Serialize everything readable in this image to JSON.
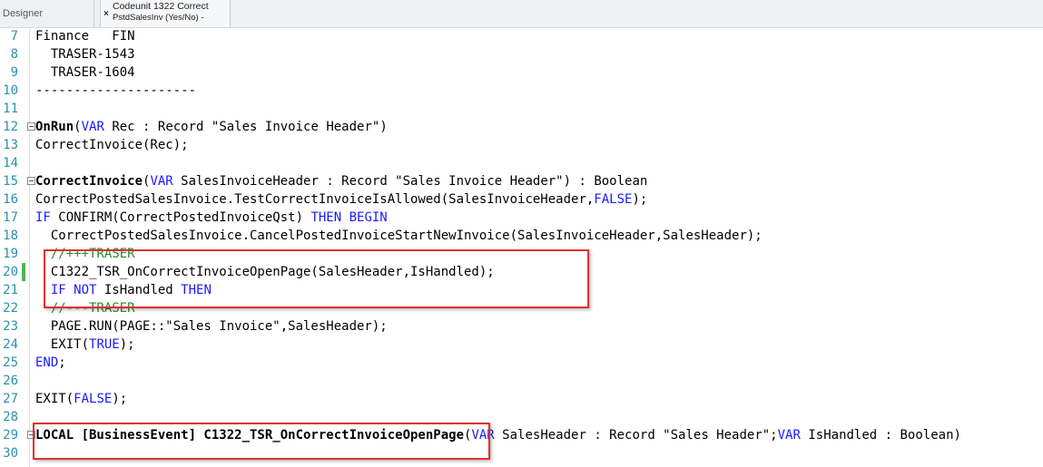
{
  "tabs": {
    "designer": "Designer",
    "codeunit_line1": "Codeunit 1322 Correct",
    "codeunit_line2": "PstdSalesInv (Yes/No) -",
    "close": "×"
  },
  "editor": {
    "lines": [
      {
        "n": "7",
        "tokens": [
          [
            "t",
            "Finance   FIN"
          ]
        ]
      },
      {
        "n": "8",
        "tokens": [
          [
            "t",
            "  TRASER-1543"
          ]
        ]
      },
      {
        "n": "9",
        "tokens": [
          [
            "t",
            "  TRASER-1604"
          ]
        ]
      },
      {
        "n": "10",
        "tokens": [
          [
            "t",
            "---------------------"
          ]
        ]
      },
      {
        "n": "11",
        "tokens": []
      },
      {
        "n": "12",
        "fold": true,
        "tokens": [
          [
            "b",
            "OnRun"
          ],
          [
            "t",
            "("
          ],
          [
            "k",
            "VAR"
          ],
          [
            "t",
            " Rec : Record \"Sales Invoice Header\")"
          ]
        ]
      },
      {
        "n": "13",
        "tokens": [
          [
            "t",
            "CorrectInvoice(Rec);"
          ]
        ]
      },
      {
        "n": "14",
        "tokens": []
      },
      {
        "n": "15",
        "fold": true,
        "tokens": [
          [
            "b",
            "CorrectInvoice"
          ],
          [
            "t",
            "("
          ],
          [
            "k",
            "VAR"
          ],
          [
            "t",
            " SalesInvoiceHeader : Record \"Sales Invoice Header\") : Boolean"
          ]
        ]
      },
      {
        "n": "16",
        "tokens": [
          [
            "t",
            "CorrectPostedSalesInvoice.TestCorrectInvoiceIsAllowed(SalesInvoiceHeader,"
          ],
          [
            "k",
            "FALSE"
          ],
          [
            "t",
            ");"
          ]
        ]
      },
      {
        "n": "17",
        "tokens": [
          [
            "k",
            "IF"
          ],
          [
            "t",
            " CONFIRM(CorrectPostedInvoiceQst) "
          ],
          [
            "k",
            "THEN BEGIN"
          ]
        ]
      },
      {
        "n": "18",
        "tokens": [
          [
            "t",
            "  CorrectPostedSalesInvoice.CancelPostedInvoiceStartNewInvoice(SalesInvoiceHeader,SalesHeader);"
          ]
        ]
      },
      {
        "n": "19",
        "tokens": [
          [
            "c",
            "  //+++TRASER"
          ]
        ]
      },
      {
        "n": "20",
        "changed": true,
        "tokens": [
          [
            "t",
            "  C1322_TSR_OnCorrectInvoiceOpenPage(SalesHeader,IsHandled);"
          ]
        ]
      },
      {
        "n": "21",
        "tokens": [
          [
            "t",
            "  "
          ],
          [
            "k",
            "IF NOT"
          ],
          [
            "t",
            " IsHandled "
          ],
          [
            "k",
            "THEN"
          ]
        ]
      },
      {
        "n": "22",
        "tokens": [
          [
            "c",
            "  //---TRASER"
          ]
        ]
      },
      {
        "n": "23",
        "tokens": [
          [
            "t",
            "  PAGE.RUN(PAGE::\"Sales Invoice\",SalesHeader);"
          ]
        ]
      },
      {
        "n": "24",
        "tokens": [
          [
            "t",
            "  EXIT("
          ],
          [
            "k",
            "TRUE"
          ],
          [
            "t",
            ");"
          ]
        ]
      },
      {
        "n": "25",
        "tokens": [
          [
            "k",
            "END"
          ],
          [
            "t",
            ";"
          ]
        ]
      },
      {
        "n": "26",
        "tokens": []
      },
      {
        "n": "27",
        "tokens": [
          [
            "t",
            "EXIT("
          ],
          [
            "k",
            "FALSE"
          ],
          [
            "t",
            ");"
          ]
        ]
      },
      {
        "n": "28",
        "tokens": []
      },
      {
        "n": "29",
        "fold": true,
        "tokens": [
          [
            "b",
            "LOCAL [BusinessEvent] C1322_TSR_OnCorrectInvoiceOpenPage"
          ],
          [
            "t",
            "("
          ],
          [
            "k",
            "VAR"
          ],
          [
            "t",
            " SalesHeader : Record \"Sales Header\";"
          ],
          [
            "k",
            "VAR"
          ],
          [
            "t",
            " IsHandled : Boolean)"
          ]
        ]
      },
      {
        "n": "30",
        "tokens": []
      }
    ]
  },
  "colors": {
    "keyword": "#1a1aff",
    "comment": "#2a8a2a",
    "line_number": "#2b91af",
    "highlight_box": "#e03030",
    "change_marker": "#55b155"
  }
}
